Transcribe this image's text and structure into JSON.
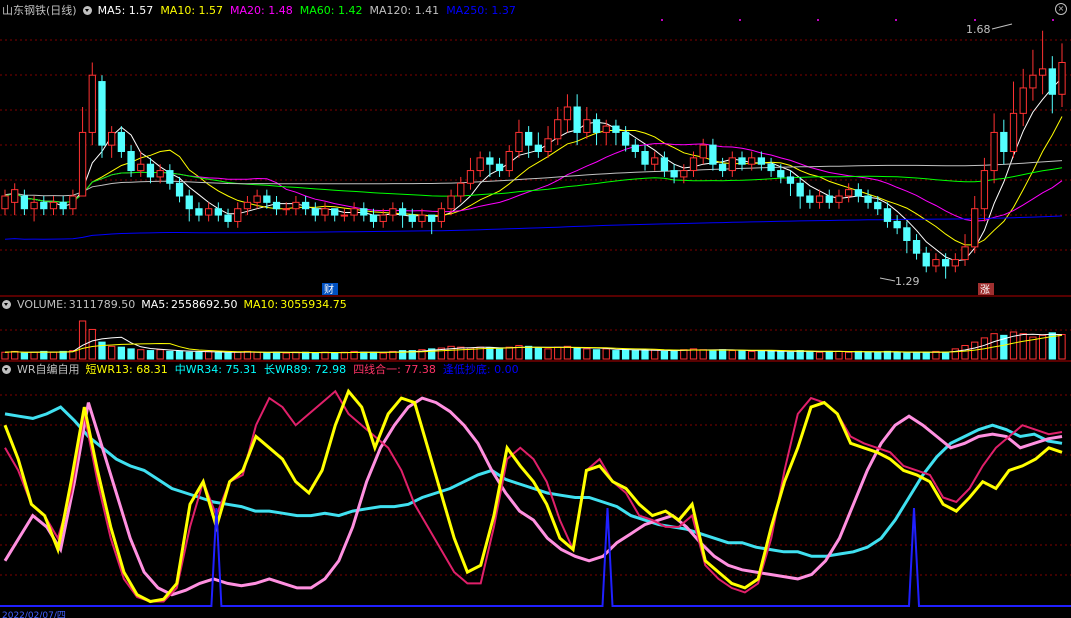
{
  "main_panel": {
    "stock_name": "山东钢铁(日线)",
    "ma": [
      {
        "label": "MA5:",
        "value": "1.57",
        "color": "#ffffff"
      },
      {
        "label": "MA10:",
        "value": "1.57",
        "color": "#ffff00"
      },
      {
        "label": "MA20:",
        "value": "1.48",
        "color": "#ff00ff"
      },
      {
        "label": "MA60:",
        "value": "1.42",
        "color": "#00ff00"
      },
      {
        "label": "MA120:",
        "value": "1.41",
        "color": "#c0c0c0"
      },
      {
        "label": "MA250:",
        "value": "1.37",
        "color": "#0000ff"
      }
    ],
    "high_label": "1.68",
    "low_label": "1.29",
    "marker_finance": "财",
    "marker_up": "涨"
  },
  "volume_panel": {
    "title": "VOLUME:",
    "value": "3111789.50",
    "ma5_label": "MA5:",
    "ma5_value": "2558692.50",
    "ma10_label": "MA10:",
    "ma10_value": "3055934.75"
  },
  "wr_panel": {
    "title": "WR自编自用",
    "items": [
      {
        "label": "短WR13:",
        "value": "68.31",
        "color": "#ffff00"
      },
      {
        "label": "中WR34:",
        "value": "75.31",
        "color": "#00ffff"
      },
      {
        "label": "长WR89:",
        "value": "72.98",
        "color": "#00ffff"
      },
      {
        "label": "四线合一:",
        "value": "77.38",
        "color": "#ff3366"
      },
      {
        "label": "逢低抄底:",
        "value": "0.00",
        "color": "#0000ff"
      }
    ]
  },
  "date_label": "2022/02/07/四",
  "chart_data": {
    "type": "candlestick",
    "price_range": [
      1.29,
      1.68
    ],
    "candle_colors": {
      "up": "#ff3232",
      "down": "#54ffff"
    },
    "ma_colors": {
      "MA5": "#ffffff",
      "MA10": "#ffff00",
      "MA20": "#ff00ff",
      "MA60": "#00ff00",
      "MA120": "#c0c0c0",
      "MA250": "#0000ff"
    },
    "candles": [
      [
        1.4,
        1.42,
        1.39,
        1.43
      ],
      [
        1.41,
        1.43,
        1.39,
        1.44
      ],
      [
        1.42,
        1.4,
        1.39,
        1.43
      ],
      [
        1.4,
        1.41,
        1.38,
        1.42
      ],
      [
        1.41,
        1.4,
        1.39,
        1.42
      ],
      [
        1.4,
        1.41,
        1.39,
        1.42
      ],
      [
        1.41,
        1.4,
        1.39,
        1.42
      ],
      [
        1.4,
        1.42,
        1.39,
        1.43
      ],
      [
        1.42,
        1.52,
        1.42,
        1.56
      ],
      [
        1.52,
        1.61,
        1.5,
        1.63
      ],
      [
        1.6,
        1.5,
        1.48,
        1.61
      ],
      [
        1.5,
        1.52,
        1.48,
        1.53
      ],
      [
        1.52,
        1.49,
        1.48,
        1.53
      ],
      [
        1.49,
        1.46,
        1.45,
        1.5
      ],
      [
        1.46,
        1.47,
        1.45,
        1.49
      ],
      [
        1.47,
        1.45,
        1.44,
        1.48
      ],
      [
        1.45,
        1.46,
        1.44,
        1.47
      ],
      [
        1.46,
        1.44,
        1.43,
        1.47
      ],
      [
        1.44,
        1.42,
        1.41,
        1.45
      ],
      [
        1.42,
        1.4,
        1.38,
        1.43
      ],
      [
        1.4,
        1.39,
        1.38,
        1.41
      ],
      [
        1.39,
        1.4,
        1.38,
        1.41
      ],
      [
        1.4,
        1.39,
        1.38,
        1.41
      ],
      [
        1.39,
        1.38,
        1.37,
        1.4
      ],
      [
        1.38,
        1.4,
        1.37,
        1.41
      ],
      [
        1.4,
        1.41,
        1.39,
        1.42
      ],
      [
        1.41,
        1.42,
        1.4,
        1.43
      ],
      [
        1.42,
        1.41,
        1.4,
        1.43
      ],
      [
        1.41,
        1.4,
        1.39,
        1.42
      ],
      [
        1.4,
        1.4,
        1.39,
        1.41
      ],
      [
        1.4,
        1.41,
        1.39,
        1.42
      ],
      [
        1.41,
        1.4,
        1.39,
        1.42
      ],
      [
        1.4,
        1.39,
        1.38,
        1.41
      ],
      [
        1.39,
        1.4,
        1.38,
        1.41
      ],
      [
        1.4,
        1.39,
        1.38,
        1.4
      ],
      [
        1.39,
        1.39,
        1.38,
        1.4
      ],
      [
        1.39,
        1.4,
        1.38,
        1.41
      ],
      [
        1.4,
        1.39,
        1.38,
        1.41
      ],
      [
        1.39,
        1.38,
        1.37,
        1.4
      ],
      [
        1.38,
        1.39,
        1.37,
        1.4
      ],
      [
        1.39,
        1.4,
        1.38,
        1.41
      ],
      [
        1.4,
        1.39,
        1.37,
        1.41
      ],
      [
        1.39,
        1.38,
        1.37,
        1.4
      ],
      [
        1.38,
        1.39,
        1.37,
        1.4
      ],
      [
        1.39,
        1.38,
        1.36,
        1.39
      ],
      [
        1.38,
        1.4,
        1.37,
        1.41
      ],
      [
        1.4,
        1.42,
        1.39,
        1.43
      ],
      [
        1.42,
        1.44,
        1.41,
        1.45
      ],
      [
        1.44,
        1.46,
        1.43,
        1.48
      ],
      [
        1.46,
        1.48,
        1.45,
        1.49
      ],
      [
        1.48,
        1.47,
        1.45,
        1.49
      ],
      [
        1.47,
        1.46,
        1.45,
        1.48
      ],
      [
        1.46,
        1.49,
        1.45,
        1.5
      ],
      [
        1.49,
        1.52,
        1.48,
        1.54
      ],
      [
        1.52,
        1.5,
        1.48,
        1.53
      ],
      [
        1.5,
        1.49,
        1.48,
        1.52
      ],
      [
        1.49,
        1.51,
        1.48,
        1.53
      ],
      [
        1.51,
        1.54,
        1.5,
        1.56
      ],
      [
        1.54,
        1.56,
        1.52,
        1.58
      ],
      [
        1.56,
        1.52,
        1.5,
        1.58
      ],
      [
        1.52,
        1.54,
        1.51,
        1.56
      ],
      [
        1.54,
        1.52,
        1.5,
        1.55
      ],
      [
        1.52,
        1.53,
        1.5,
        1.54
      ],
      [
        1.53,
        1.52,
        1.5,
        1.54
      ],
      [
        1.52,
        1.5,
        1.49,
        1.53
      ],
      [
        1.5,
        1.49,
        1.48,
        1.51
      ],
      [
        1.49,
        1.47,
        1.46,
        1.5
      ],
      [
        1.47,
        1.48,
        1.46,
        1.49
      ],
      [
        1.48,
        1.46,
        1.45,
        1.49
      ],
      [
        1.46,
        1.45,
        1.44,
        1.47
      ],
      [
        1.45,
        1.46,
        1.44,
        1.47
      ],
      [
        1.46,
        1.48,
        1.45,
        1.49
      ],
      [
        1.48,
        1.5,
        1.47,
        1.51
      ],
      [
        1.5,
        1.47,
        1.46,
        1.51
      ],
      [
        1.47,
        1.46,
        1.45,
        1.48
      ],
      [
        1.46,
        1.48,
        1.45,
        1.49
      ],
      [
        1.48,
        1.47,
        1.46,
        1.49
      ],
      [
        1.47,
        1.48,
        1.46,
        1.49
      ],
      [
        1.48,
        1.47,
        1.46,
        1.49
      ],
      [
        1.47,
        1.46,
        1.45,
        1.48
      ],
      [
        1.46,
        1.45,
        1.44,
        1.47
      ],
      [
        1.45,
        1.44,
        1.42,
        1.46
      ],
      [
        1.44,
        1.42,
        1.4,
        1.45
      ],
      [
        1.42,
        1.41,
        1.4,
        1.43
      ],
      [
        1.41,
        1.42,
        1.4,
        1.43
      ],
      [
        1.42,
        1.41,
        1.4,
        1.43
      ],
      [
        1.41,
        1.42,
        1.4,
        1.43
      ],
      [
        1.42,
        1.43,
        1.41,
        1.44
      ],
      [
        1.43,
        1.42,
        1.41,
        1.44
      ],
      [
        1.42,
        1.41,
        1.4,
        1.43
      ],
      [
        1.41,
        1.4,
        1.39,
        1.42
      ],
      [
        1.4,
        1.38,
        1.37,
        1.41
      ],
      [
        1.38,
        1.37,
        1.36,
        1.39
      ],
      [
        1.37,
        1.35,
        1.33,
        1.38
      ],
      [
        1.35,
        1.33,
        1.32,
        1.36
      ],
      [
        1.33,
        1.31,
        1.3,
        1.34
      ],
      [
        1.31,
        1.32,
        1.3,
        1.33
      ],
      [
        1.32,
        1.31,
        1.29,
        1.33
      ],
      [
        1.31,
        1.32,
        1.3,
        1.33
      ],
      [
        1.32,
        1.34,
        1.31,
        1.36
      ],
      [
        1.34,
        1.4,
        1.33,
        1.42
      ],
      [
        1.4,
        1.46,
        1.38,
        1.48
      ],
      [
        1.46,
        1.52,
        1.44,
        1.55
      ],
      [
        1.52,
        1.49,
        1.47,
        1.54
      ],
      [
        1.49,
        1.55,
        1.48,
        1.6
      ],
      [
        1.55,
        1.59,
        1.53,
        1.62
      ],
      [
        1.59,
        1.61,
        1.57,
        1.65
      ],
      [
        1.61,
        1.62,
        1.58,
        1.68
      ],
      [
        1.62,
        1.58,
        1.55,
        1.64
      ],
      [
        1.58,
        1.63,
        1.56,
        1.66
      ]
    ],
    "volume": [
      0.8,
      0.9,
      0.7,
      0.8,
      0.9,
      0.8,
      0.9,
      1.0,
      4.5,
      3.5,
      2.0,
      1.5,
      1.4,
      1.2,
      1.1,
      1.0,
      1.1,
      0.9,
      0.9,
      0.8,
      0.8,
      0.9,
      0.8,
      0.7,
      0.8,
      0.9,
      0.8,
      0.7,
      0.8,
      0.7,
      0.8,
      0.8,
      0.7,
      0.8,
      0.7,
      0.8,
      0.9,
      0.8,
      0.8,
      0.7,
      0.9,
      1.0,
      1.0,
      1.1,
      1.2,
      1.3,
      1.5,
      1.4,
      1.3,
      1.4,
      1.3,
      1.2,
      1.4,
      1.6,
      1.5,
      1.3,
      1.2,
      1.4,
      1.5,
      1.3,
      1.2,
      1.1,
      1.2,
      1.0,
      1.1,
      1.0,
      1.0,
      1.1,
      0.9,
      1.0,
      1.1,
      1.2,
      1.1,
      1.0,
      1.1,
      1.0,
      1.0,
      0.9,
      1.0,
      0.9,
      0.9,
      0.8,
      1.0,
      0.9,
      0.8,
      0.9,
      0.9,
      0.8,
      0.9,
      0.8,
      0.8,
      0.9,
      0.8,
      0.7,
      0.8,
      0.8,
      0.9,
      0.8,
      1.2,
      1.6,
      2.0,
      2.5,
      3.0,
      2.8,
      3.2,
      3.0,
      2.6,
      2.8,
      3.1,
      2.9
    ],
    "wr_series": {
      "short_wr13": [
        80,
        65,
        45,
        40,
        25,
        55,
        88,
        60,
        35,
        15,
        5,
        2,
        3,
        10,
        45,
        55,
        35,
        55,
        60,
        75,
        70,
        65,
        55,
        50,
        60,
        80,
        95,
        88,
        70,
        85,
        92,
        90,
        70,
        50,
        30,
        15,
        18,
        40,
        70,
        62,
        55,
        45,
        30,
        25,
        60,
        62,
        55,
        52,
        45,
        40,
        42,
        38,
        45,
        20,
        15,
        10,
        8,
        12,
        35,
        55,
        70,
        88,
        90,
        85,
        72,
        70,
        68,
        65,
        60,
        58,
        55,
        45,
        42,
        48,
        55,
        52,
        60,
        62,
        65,
        70,
        68
      ],
      "long_wr89": [
        85,
        84,
        83,
        85,
        88,
        82,
        75,
        70,
        65,
        62,
        60,
        56,
        52,
        50,
        48,
        46,
        45,
        44,
        42,
        42,
        41,
        40,
        40,
        41,
        40,
        42,
        43,
        44,
        44,
        45,
        48,
        50,
        52,
        55,
        58,
        60,
        56,
        54,
        52,
        50,
        49,
        48,
        48,
        46,
        44,
        40,
        38,
        36,
        35,
        34,
        32,
        30,
        28,
        28,
        26,
        25,
        24,
        24,
        22,
        22,
        23,
        24,
        26,
        30,
        38,
        48,
        58,
        66,
        72,
        75,
        78,
        80,
        78,
        75,
        76,
        73,
        72
      ],
      "mid_wr34": [
        20,
        30,
        40,
        35,
        25,
        55,
        90,
        70,
        50,
        30,
        15,
        8,
        5,
        7,
        10,
        12,
        10,
        9,
        10,
        12,
        10,
        8,
        8,
        12,
        20,
        35,
        55,
        70,
        80,
        88,
        92,
        90,
        86,
        80,
        72,
        60,
        50,
        42,
        38,
        30,
        25,
        22,
        20,
        22,
        28,
        32,
        36,
        38,
        40,
        35,
        28,
        22,
        18,
        16,
        15,
        14,
        13,
        12,
        14,
        20,
        30,
        45,
        60,
        72,
        80,
        84,
        80,
        75,
        70,
        72,
        75,
        76,
        75,
        70,
        72,
        74,
        75
      ],
      "four_in_one": [
        70,
        60,
        45,
        40,
        30,
        50,
        85,
        55,
        30,
        12,
        4,
        2,
        2,
        8,
        35,
        55,
        40,
        55,
        58,
        80,
        92,
        88,
        80,
        85,
        90,
        95,
        85,
        80,
        75,
        70,
        60,
        45,
        35,
        25,
        15,
        10,
        10,
        35,
        65,
        70,
        65,
        55,
        38,
        25,
        60,
        65,
        55,
        50,
        40,
        38,
        35,
        35,
        40,
        18,
        12,
        8,
        6,
        10,
        30,
        60,
        85,
        92,
        90,
        85,
        75,
        72,
        70,
        68,
        62,
        60,
        58,
        48,
        46,
        52,
        62,
        70,
        75,
        80,
        78,
        76,
        77
      ],
      "bottom_signal_peaks": [
        0.2,
        0.57,
        0.86
      ]
    }
  }
}
